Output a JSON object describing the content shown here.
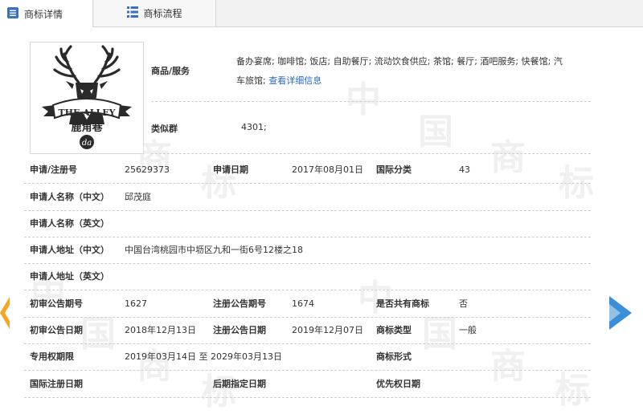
{
  "tabs": [
    {
      "label": "商标详情"
    },
    {
      "label": "商标流程"
    }
  ],
  "watermark": [
    "中",
    "国",
    "商",
    "标"
  ],
  "logo": {
    "text": "THE ALLEY",
    "chinese": "鹿角巷",
    "mono": "da"
  },
  "goods": {
    "label": "商品/服务",
    "line1": "备办宴席; 咖啡馆; 饭店; 自助餐厅; 流动饮食供应; 茶馆; 餐厅; 酒吧服务; 快餐馆; 汽",
    "line2": "车旅馆; ",
    "link": "查看详细信息"
  },
  "similar": {
    "label": "类似群",
    "value": "4301;"
  },
  "rows": {
    "r1": {
      "a_label": "申请/注册号",
      "a_value": "25629373",
      "b_label": "申请日期",
      "b_value": "2017年08月01日",
      "c_label": "国际分类",
      "c_value": "43"
    },
    "r2": {
      "a_label": "申请人名称（中文）",
      "a_value": "邱茂庭"
    },
    "r3": {
      "a_label": "申请人名称（英文）",
      "a_value": ""
    },
    "r4": {
      "a_label": "申请人地址（中文）",
      "a_value": "中国台湾桃园市中坜区九和一街6号12楼之18"
    },
    "r5": {
      "a_label": "申请人地址（英文）",
      "a_value": ""
    },
    "r6": {
      "a_label": "初审公告期号",
      "a_value": "1627",
      "b_label": "注册公告期号",
      "b_value": "1674",
      "c_label": "是否共有商标",
      "c_value": "否"
    },
    "r7": {
      "a_label": "初审公告日期",
      "a_value": "2018年12月13日",
      "b_label": "注册公告日期",
      "b_value": "2019年12月07日",
      "c_label": "商标类型",
      "c_value": "一般"
    },
    "r8": {
      "a_label": "专用权期限",
      "a_value": "2019年03月14日 至 2029年03月13日",
      "c_label": "商标形式",
      "c_value": ""
    },
    "r9": {
      "a_label": "国际注册日期",
      "a_value": "",
      "b_label": "后期指定日期",
      "b_value": "",
      "c_label": "优先权日期",
      "c_value": ""
    }
  },
  "colors": {
    "accent": "#4a90d9",
    "arrow_left": "#f5a623",
    "arrow_right": "#3b8fd6"
  }
}
